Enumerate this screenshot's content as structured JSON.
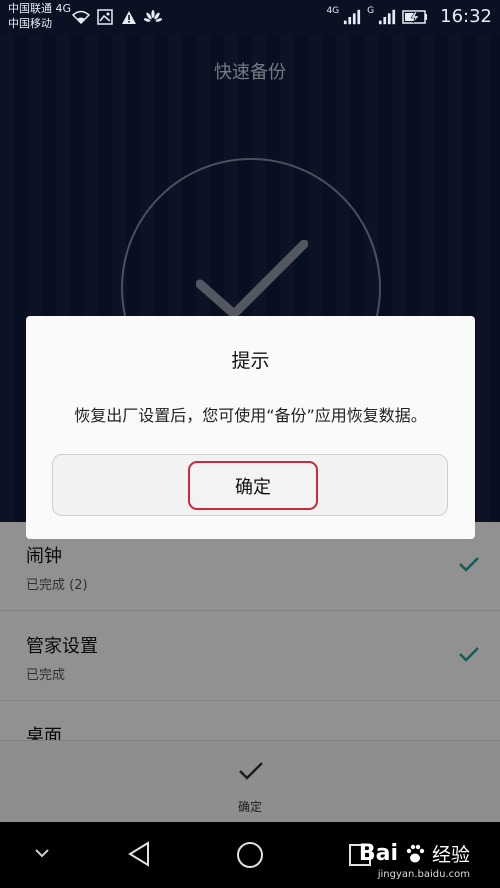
{
  "status_bar": {
    "carrier_1": "中国联通 4G",
    "carrier_2": "中国移动",
    "signal_1_label": "4G",
    "signal_2_label": "G",
    "time": "16:32",
    "icons": [
      "wifi-icon",
      "image-icon",
      "warning-icon",
      "huawei-icon",
      "signal-icon",
      "signal-icon",
      "battery-charging-icon"
    ]
  },
  "app": {
    "title": "快速备份",
    "list": [
      {
        "title": "闹钟",
        "subtitle": "已完成 (2)"
      },
      {
        "title": "管家设置",
        "subtitle": "已完成"
      },
      {
        "title": "桌面",
        "subtitle": ""
      }
    ],
    "bottom_button_label": "确定"
  },
  "dialog": {
    "title": "提示",
    "message": "恢复出厂设置后，您可使用“备份”应用恢复数据。",
    "confirm_label": "确定"
  },
  "nav_bar": {
    "buttons": [
      "chevron-down-icon",
      "back-icon",
      "home-icon",
      "recents-icon"
    ]
  },
  "watermark": {
    "brand": "Bai",
    "brand_suffix": "经验",
    "url": "jingyan.baidu.com"
  },
  "colors": {
    "accent_check": "#2a9d9a",
    "highlight_border": "#c9293a",
    "app_background": "#0f1a3a"
  }
}
